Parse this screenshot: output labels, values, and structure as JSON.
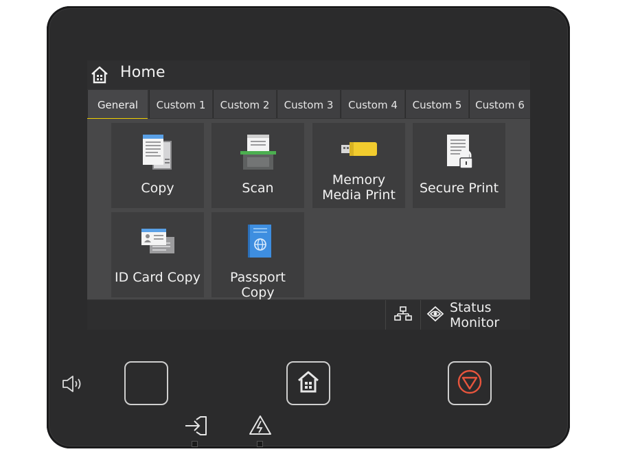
{
  "header": {
    "title": "Home",
    "icon": "home-icon"
  },
  "tabs": [
    {
      "label": "General",
      "active": true
    },
    {
      "label": "Custom 1"
    },
    {
      "label": "Custom 2"
    },
    {
      "label": "Custom 3"
    },
    {
      "label": "Custom 4"
    },
    {
      "label": "Custom 5"
    },
    {
      "label": "Custom 6"
    }
  ],
  "tiles": [
    {
      "label": "Copy",
      "icon": "copy-icon"
    },
    {
      "label": "Scan",
      "icon": "scan-icon"
    },
    {
      "label_line1": "Memory",
      "label_line2": "Media Print",
      "icon": "usb-memory-icon"
    },
    {
      "label": "Secure Print",
      "icon": "secure-print-icon"
    },
    {
      "label": "ID Card Copy",
      "icon": "id-card-icon"
    },
    {
      "label": "Passport Copy",
      "icon": "passport-icon"
    }
  ],
  "statusbar": {
    "network_icon": "network-icon",
    "status_label": "Status Monitor",
    "status_icon": "eye-icon"
  },
  "hardware": {
    "sound_icon": "speaker-icon",
    "sleep_icon": "moon-icon",
    "home_icon": "home-icon",
    "stop_icon": "stop-icon",
    "data_icon": "login-arrow-icon",
    "error_icon": "warning-icon"
  },
  "colors": {
    "accent": "#f2d100",
    "stop": "#e8553d",
    "panel": "#2b2b2c"
  }
}
